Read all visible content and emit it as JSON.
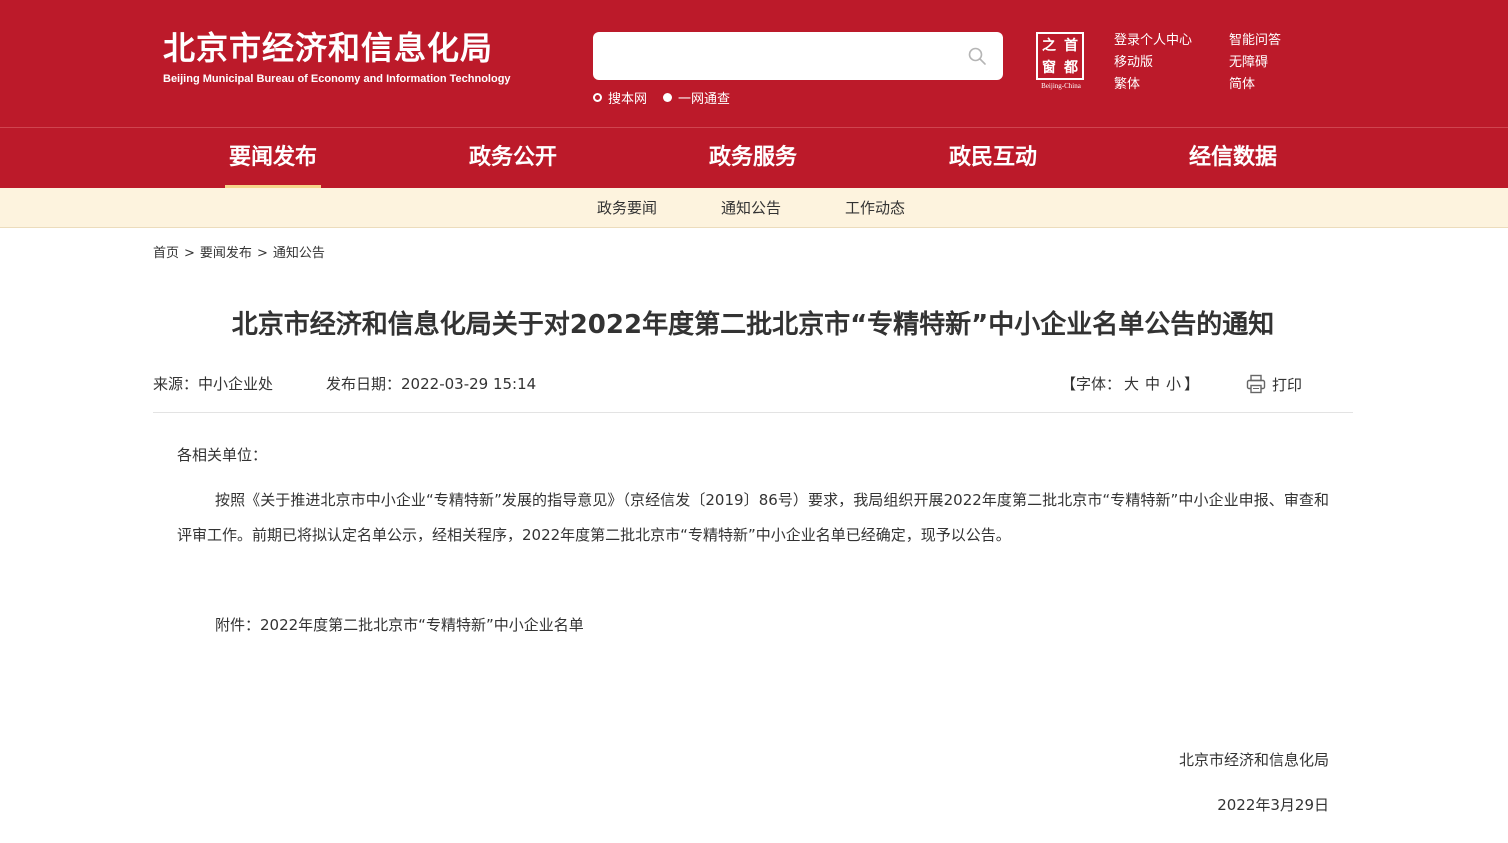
{
  "header": {
    "site_title": "北京市经济和信息化局",
    "site_subtitle": "Beijing Municipal Bureau of Economy and Information Technology",
    "search": {
      "placeholder": "",
      "scopes": [
        "搜本网",
        "一网通查"
      ],
      "selected_scope": "一网通查"
    },
    "logo": {
      "chars": [
        "之",
        "首",
        "窗",
        "都"
      ],
      "caption": "Beijing-China"
    },
    "links_col1": [
      "登录个人中心",
      "移动版",
      "繁体"
    ],
    "links_col2": [
      "智能问答",
      "无障碍",
      "简体"
    ]
  },
  "nav": {
    "items": [
      "要闻发布",
      "政务公开",
      "政务服务",
      "政民互动",
      "经信数据"
    ],
    "active": "要闻发布"
  },
  "subnav": {
    "items": [
      "政务要闻",
      "通知公告",
      "工作动态"
    ]
  },
  "breadcrumb": {
    "items": [
      "首页",
      "要闻发布",
      "通知公告"
    ],
    "separator": ">"
  },
  "article": {
    "title": "北京市经济和信息化局关于对2022年度第二批北京市“专精特新”中小企业名单公告的通知",
    "source_label": "来源：",
    "source": "中小企业处",
    "date_label": "发布日期：",
    "date": "2022-03-29 15:14",
    "font_size_label": "【字体：",
    "font_sizes": [
      "大",
      "中",
      "小"
    ],
    "font_size_close": "】",
    "print_label": "打印",
    "salutation": "各相关单位：",
    "paragraph": "按照《关于推进北京市中小企业“专精特新”发展的指导意见》（京经信发〔2019〕86号）要求，我局组织开展2022年度第二批北京市“专精特新”中小企业申报、审查和评审工作。前期已将拟认定名单公示，经相关程序，2022年度第二批北京市“专精特新”中小企业名单已经确定，现予以公告。",
    "attachment": "附件：2022年度第二批北京市“专精特新”中小企业名单",
    "signature_org": "北京市经济和信息化局",
    "signature_date": "2022年3月29日"
  },
  "colors": {
    "brand_red": "#bc1a2a",
    "subnav_bg": "#fdf3de",
    "active_underline": "#f6d48a"
  }
}
